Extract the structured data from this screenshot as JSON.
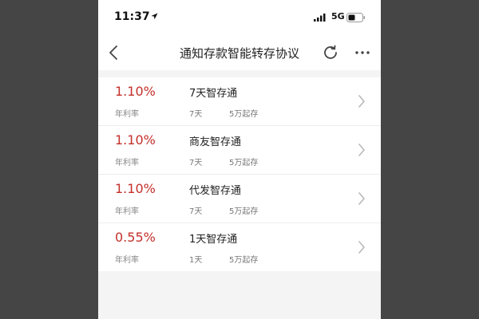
{
  "status_bar": {
    "time": "11:37",
    "network": "5G"
  },
  "nav": {
    "title": "通知存款智能转存协议"
  },
  "products": [
    {
      "rate": "1.10%",
      "rate_label": "年利率",
      "name": "7天智存通",
      "term": "7天",
      "min_amount": "5万起存"
    },
    {
      "rate": "1.10%",
      "rate_label": "年利率",
      "name": "商友智存通",
      "term": "7天",
      "min_amount": "5万起存"
    },
    {
      "rate": "1.10%",
      "rate_label": "年利率",
      "name": "代发智存通",
      "term": "7天",
      "min_amount": "5万起存"
    },
    {
      "rate": "0.55%",
      "rate_label": "年利率",
      "name": "1天智存通",
      "term": "1天",
      "min_amount": "5万起存"
    }
  ],
  "colors": {
    "rate": "#c4302b",
    "page_background": "#f4f4f4",
    "outer_background": "#454545"
  },
  "icons": {
    "back": "chevron-left-icon",
    "refresh": "refresh-icon",
    "more": "more-icon",
    "row_arrow": "chevron-right-icon"
  }
}
